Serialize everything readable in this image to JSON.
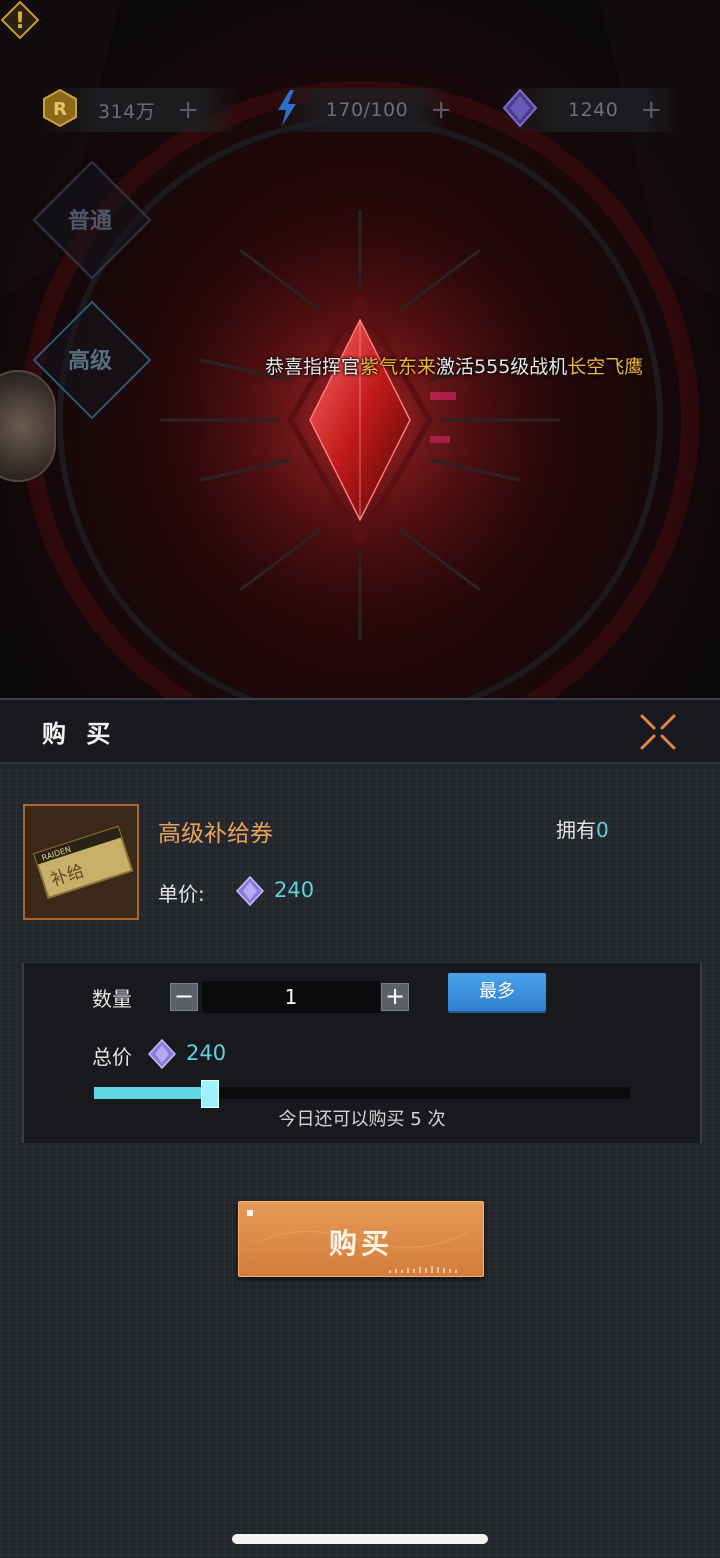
{
  "resources": {
    "coins": {
      "icon": "r-coin-icon",
      "value": "314万",
      "plus": "+"
    },
    "energy": {
      "icon": "lightning-icon",
      "value": "170/100",
      "plus": "+"
    },
    "gems": {
      "icon": "gem-icon",
      "value": "1240",
      "plus": "+"
    }
  },
  "modes": {
    "normal": "普通",
    "advanced": "高级"
  },
  "announcement": {
    "prefix": "恭喜指挥官",
    "player": "紫气东来",
    "middle": "激活555级战机",
    "plane": "长空飞鹰"
  },
  "colors": {
    "highlight": "#f3b43b",
    "cyan": "#5fd2de",
    "item_name": "#e9a35a",
    "buy_button": "#e08b48",
    "max_button": "#3a8fdd"
  },
  "modal": {
    "title": "购 买",
    "item": {
      "name": "高级补给券",
      "owned_label": "拥有",
      "owned_count": "0",
      "unit_label": "单价:",
      "unit_price": "240",
      "thumb_text": "补给",
      "thumb_brand": "RAIDEN"
    },
    "quantity": {
      "label": "数量",
      "minus": "−",
      "plus": "+",
      "value": "1",
      "max_label": "最多"
    },
    "total": {
      "label": "总价",
      "value": "240"
    },
    "slider": {
      "fraction": 0.2
    },
    "remaining_text": "今日还可以购买 5 次",
    "buy_label": "购买"
  }
}
